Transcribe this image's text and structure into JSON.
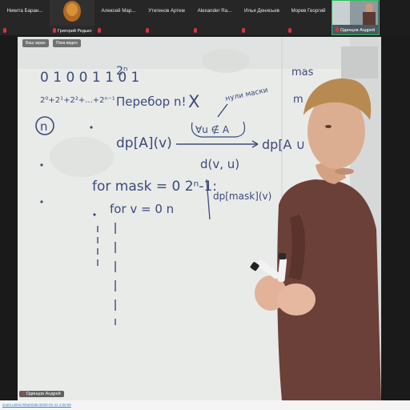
{
  "participants": [
    {
      "name": "Никита Баран...",
      "kind": "name"
    },
    {
      "name": "Григорий Редько",
      "kind": "photo"
    },
    {
      "name": "Алексей Мар...",
      "kind": "name"
    },
    {
      "name": "Утегенов Артем",
      "kind": "name"
    },
    {
      "name": "Alexander Ra...",
      "kind": "name"
    },
    {
      "name": "Илья Денисьев",
      "kind": "name"
    },
    {
      "name": "Морев Георгий",
      "kind": "name"
    },
    {
      "name": "Одинцов Андрей",
      "kind": "self"
    }
  ],
  "stage": {
    "top_chip_1": "Ваш экран",
    "top_chip_2": "Пока видео",
    "speaker_name": "Одинцов Андрей"
  },
  "whiteboard": {
    "lines": [
      "0 1 0 0 1 1 0 1",
      "2ⁿ",
      "2⁰+2¹+2²+...+2ⁿ⁻¹",
      "n",
      "Перебор n!",
      "X",
      "нули маски",
      "dp[A](v)",
      "∀u ∉ A",
      "dp[A ∪ {u}]",
      "d(v, u)",
      "for mask = 0   2ⁿ-1:",
      "for v = 0  n",
      "dp[mask](v)",
      "mas",
      "m"
    ]
  },
  "footer": {
    "link": "zoom.us/rec/share/abc/2022-01-11 1:02:05"
  },
  "colors": {
    "active_speaker_border": "#2dbf5a",
    "muted_mic": "#d4373b",
    "ink": "#3c4a7a"
  }
}
